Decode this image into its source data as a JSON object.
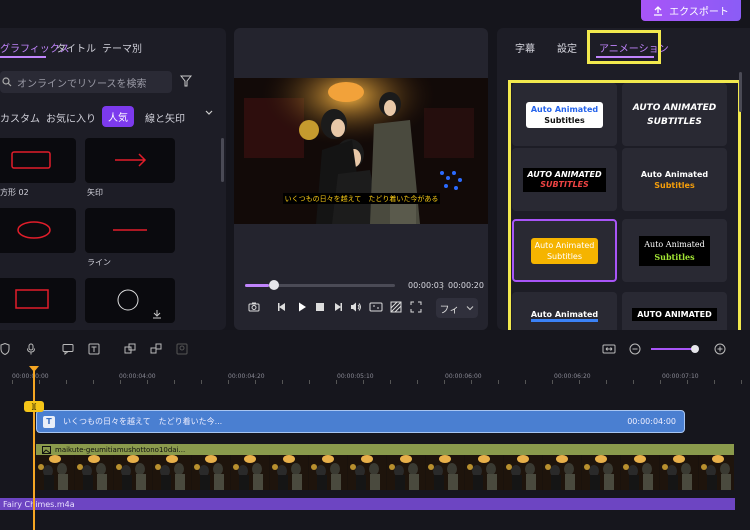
{
  "header": {
    "export_label": "エクスポート"
  },
  "library": {
    "tabs": [
      "グラフィックス",
      "タイトル",
      "テーマ別"
    ],
    "search_placeholder": "オンラインでリソースを検索",
    "chips": [
      "カスタム",
      "お気に入り",
      "人気",
      "線と矢印"
    ],
    "items": [
      {
        "label": "方形 02"
      },
      {
        "label": "矢印"
      },
      {
        "label": ""
      },
      {
        "label": "ライン"
      },
      {
        "label": ""
      },
      {
        "label": ""
      }
    ]
  },
  "preview": {
    "subtitle_text": "いくつもの日々を越えて　たどり着いた今がある",
    "time_current": "00:00:03",
    "time_sep": "|",
    "time_total": "00:00:20",
    "progress": 0.16,
    "fit_label": "フィ"
  },
  "right_panel": {
    "tabs": [
      "字幕",
      "設定",
      "アニメーション"
    ],
    "animations": [
      {
        "line1": "Auto Animated",
        "line2": "Subtitles"
      },
      {
        "line1": "AUTO ANIMATED",
        "line2": "SUBTITLES"
      },
      {
        "line1": "AUTO ANIMATED",
        "line2": "SUBTITLES"
      },
      {
        "line1": "Auto Animated",
        "line2": "Subtitles"
      },
      {
        "line1": "Auto Animated",
        "line2": "Subtitles"
      },
      {
        "line1": "Auto Animated",
        "line2": "Subtitles"
      },
      {
        "line1": "Auto Animated",
        "line2": ""
      },
      {
        "line1": "AUTO ANIMATED",
        "line2": ""
      }
    ]
  },
  "timeline": {
    "ruler": [
      "00:00:00:00",
      "00:00:04:00",
      "00:00:04:20",
      "00:00:05:10",
      "00:00:06:00",
      "00:00:06:20",
      "00:00:07:10"
    ],
    "playhead_label": "][",
    "subtitle_clip": {
      "icon": "T",
      "text": "いくつもの日々を越えて　たどり着いた今...",
      "time": "00:00:04:00"
    },
    "video_clip": {
      "name": "maikute-geumitiamushottono10dai..."
    },
    "audio_clip": {
      "name": "Fairy Chimes.m4a"
    },
    "zoom": 0.95
  }
}
